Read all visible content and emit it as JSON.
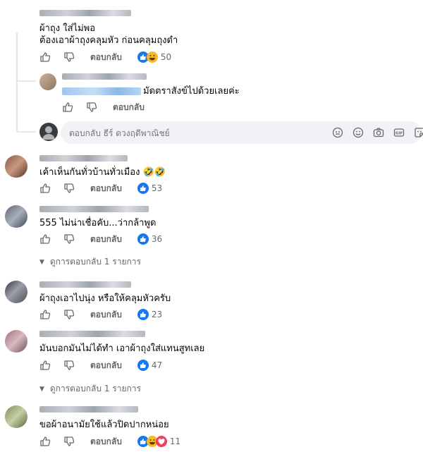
{
  "comments": [
    {
      "id": "c1",
      "lines": [
        "ผ้าถุง ใส่ไม่พอ",
        "ต้องเอาผ้าถุงคลุมหัว ก่อนคลุมถุงดำ"
      ],
      "reply_label": "ตอบกลับ",
      "reaction_count": "50",
      "reactions": [
        "like",
        "laugh"
      ]
    },
    {
      "id": "c3",
      "lines": [
        "เค้าเห็นกันทั่วบ้านทั่วเมือง 🤣🤣"
      ],
      "reply_label": "ตอบกลับ",
      "reaction_count": "53",
      "reactions": [
        "like"
      ]
    },
    {
      "id": "c4",
      "lines": [
        "555 ไม่น่าเชื่อคับ...ว่ากล้าพูด"
      ],
      "reply_label": "ตอบกลับ",
      "reaction_count": "36",
      "reactions": [
        "like"
      ],
      "view_replies": "ดูการตอบกลับ 1 รายการ"
    },
    {
      "id": "c5",
      "lines": [
        "ผ้าถุงเอาไปนุ่ง หรือให้คลุมหัวครับ"
      ],
      "reply_label": "ตอบกลับ",
      "reaction_count": "23",
      "reactions": [
        "like"
      ]
    },
    {
      "id": "c6",
      "lines": [
        "มันบอกมันไม่ได้ทำ เอาผ้าถุงใส่แทนสูทเลย"
      ],
      "reply_label": "ตอบกลับ",
      "reaction_count": "47",
      "reactions": [
        "like"
      ],
      "view_replies": "ดูการตอบกลับ 1 รายการ"
    },
    {
      "id": "c7",
      "lines": [
        "ขอผ้าอนามัยใช้แล้วปิดปากหน่อย"
      ],
      "reply_label": "ตอบกลับ",
      "reaction_count": "11",
      "reactions": [
        "like",
        "laugh",
        "love"
      ]
    }
  ],
  "nested_reply": {
    "text": "มัดตราสังข์ไปด้วยเลยค่ะ",
    "reply_label": "ตอบกลับ"
  },
  "reply_input": {
    "placeholder": "ตอบกลับ ธีร์ ดวงฤดีพาณิชย์"
  },
  "colors": {
    "like": "#1877f2",
    "laugh": "#f7b928",
    "love": "#f33e58",
    "muted": "#65676b",
    "bubble": "#f0f2f5"
  },
  "icons": [
    "thumbs-up-icon",
    "thumbs-down-icon",
    "avatar-icon",
    "gif-icon",
    "sticker-icon",
    "camera-icon",
    "emoji-icon",
    "chevron-down-icon"
  ]
}
